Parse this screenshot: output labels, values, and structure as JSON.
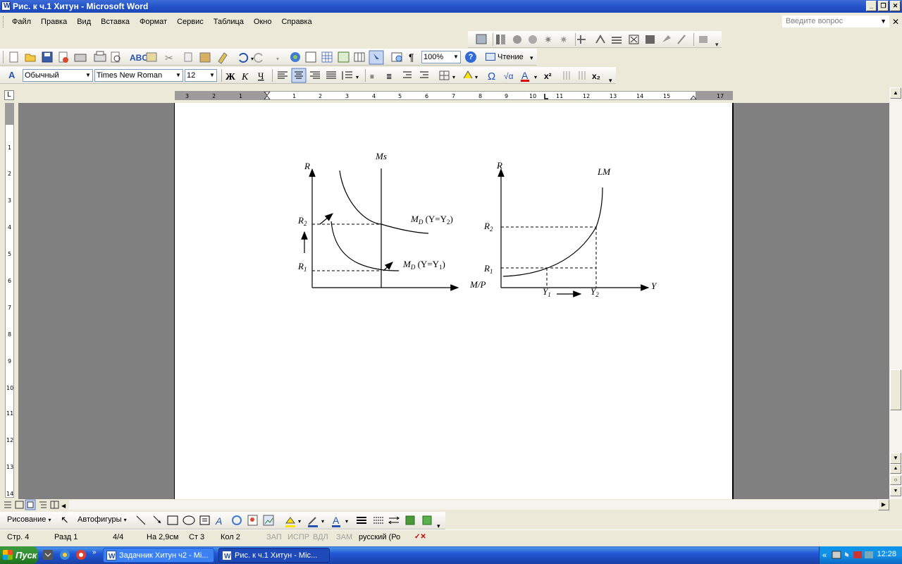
{
  "window": {
    "title": "Рис. к ч.1 Хитун - Microsoft Word"
  },
  "menu": {
    "items": [
      "Файл",
      "Правка",
      "Вид",
      "Вставка",
      "Формат",
      "Сервис",
      "Таблица",
      "Окно",
      "Справка"
    ],
    "ask_placeholder": "Введите вопрос"
  },
  "standard_toolbar": {
    "zoom": "100%",
    "reading_label": "Чтение"
  },
  "formatting_toolbar": {
    "style": "Обычный",
    "font": "Times New Roman",
    "size": "12"
  },
  "ruler": {
    "h_labels": [
      "3",
      "2",
      "1",
      "1",
      "2",
      "3",
      "4",
      "5",
      "6",
      "7",
      "8",
      "9",
      "10",
      "11",
      "12",
      "13",
      "14",
      "15",
      "17"
    ],
    "v_labels": [
      "1",
      "2",
      "3",
      "4",
      "5",
      "6",
      "7",
      "8",
      "9",
      "10",
      "11",
      "12",
      "13",
      "14"
    ]
  },
  "figure": {
    "left": {
      "y_axis": "R",
      "x_axis": "M/P",
      "supply": "Ms",
      "r2": "R",
      "r2_sub": "2",
      "r1": "R",
      "r1_sub": "1",
      "md2_main": "M",
      "md2_sub": "D",
      "md2_tail_pre": " (Y=Y",
      "md2_tail_sub": "2",
      "md2_tail_post": ")",
      "md1_main": "M",
      "md1_sub": "D",
      "md1_tail_pre": " (Y=Y",
      "md1_tail_sub": "1",
      "md1_tail_post": ")"
    },
    "right": {
      "y_axis": "R",
      "x_axis": "Y",
      "curve": "LM",
      "r2": "R",
      "r2_sub": "2",
      "r1": "R",
      "r1_sub": "1",
      "y1": "Y",
      "y1_sub": "1",
      "y2": "Y",
      "y2_sub": "2"
    }
  },
  "drawing_toolbar": {
    "draw_label": "Рисование",
    "autoshapes_label": "Автофигуры"
  },
  "status": {
    "page": "Стр. 4",
    "section": "Разд 1",
    "pages": "4/4",
    "at": "На 2,9см",
    "line": "Ст 3",
    "col": "Кол 2",
    "rec": "ЗАП",
    "trk": "ИСПР",
    "ext": "ВДЛ",
    "ovr": "ЗАМ",
    "lang": "русский (Ро"
  },
  "taskbar": {
    "start_label": "Пуск",
    "tasks": [
      "Задачник Хитун ч2 - Mi...",
      "Рис. к ч.1 Хитун - Mic..."
    ],
    "clock": "12:28"
  }
}
